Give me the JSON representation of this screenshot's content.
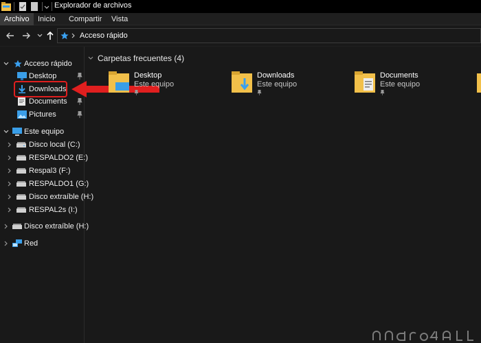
{
  "window": {
    "title": "Explorador de archivos"
  },
  "ribbon": {
    "tabs": [
      {
        "label": "Archivo",
        "active": true
      },
      {
        "label": "Inicio",
        "active": false
      },
      {
        "label": "Compartir",
        "active": false
      },
      {
        "label": "Vista",
        "active": false
      }
    ]
  },
  "nav": {
    "address_path": "Acceso rápido"
  },
  "sidebar": {
    "quick_access": "Acceso rápido",
    "pinned": [
      "Desktop",
      "Downloads",
      "Documents",
      "Pictures"
    ],
    "this_pc": "Este equipo",
    "drives": [
      "Disco local (C:)",
      "RESPALDO2 (E:)",
      "Respal3 (F:)",
      "RESPALDO1 (G:)",
      "Disco extraíble (H:)",
      "RESPAL2s (I:)"
    ],
    "removable": "Disco extraíble (H:)",
    "network": "Red"
  },
  "main": {
    "section_title": "Carpetas frecuentes (4)",
    "folders": [
      {
        "name": "Desktop",
        "location": "Este equipo",
        "icon": "desktop-folder-icon"
      },
      {
        "name": "Downloads",
        "location": "Este equipo",
        "icon": "downloads-folder-icon"
      },
      {
        "name": "Documents",
        "location": "Este equipo",
        "icon": "documents-folder-icon"
      }
    ]
  },
  "annotation": {
    "color": "#e01f1f"
  },
  "colors": {
    "accent_blue": "#3aa0f0",
    "folder_yellow": "#f2c04a"
  }
}
